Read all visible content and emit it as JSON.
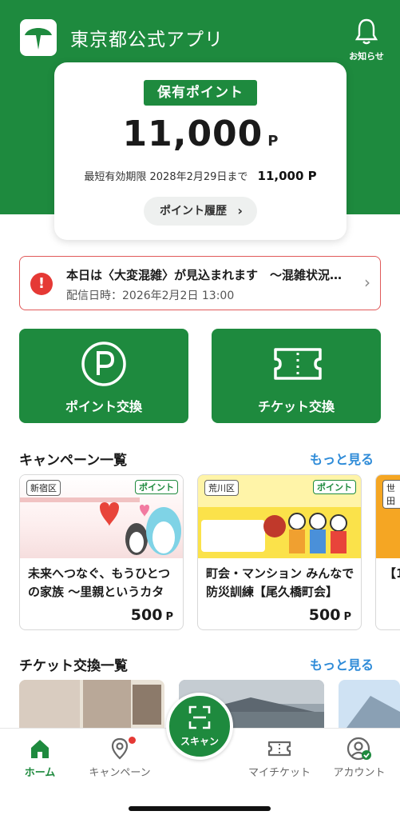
{
  "header": {
    "title": "東京都公式アプリ",
    "notifications_label": "お知らせ"
  },
  "points_card": {
    "badge": "保有ポイント",
    "value": "11,000",
    "unit": "P",
    "expiry_label": "最短有効期限",
    "expiry_date": "2028年2月29日まで",
    "expiry_amount": "11,000 P",
    "history_button": "ポイント履歴"
  },
  "alert": {
    "icon": "!",
    "title": "本日は〈大変混雑〉が見込まれます　～混雑状況について～",
    "date": "配信日時：2026年2月2日 13:00"
  },
  "actions": {
    "point_exchange": "ポイント交換",
    "ticket_exchange": "チケット交換"
  },
  "campaigns": {
    "section_title": "キャンペーン一覧",
    "more_label": "もっと見る",
    "items": [
      {
        "ward": "新宿区",
        "tag": "ポイント",
        "title": "未来へつなぐ、もうひとつの家族 〜里親というカタチ〜",
        "points": "500",
        "unit": "P"
      },
      {
        "ward": "荒川区",
        "tag": "ポイント",
        "title": "町会・マンション みんなで防災訓練【尾久橋町会】",
        "points": "500",
        "unit": "P"
      },
      {
        "ward": "世田",
        "title": "【1"
      }
    ]
  },
  "tickets": {
    "section_title": "チケット交換一覧",
    "more_label": "もっと見る"
  },
  "bottom_nav": {
    "home": "ホーム",
    "campaign": "キャンペーン",
    "scan": "スキャン",
    "my_ticket": "マイチケット",
    "account": "アカウント"
  },
  "colors": {
    "brand_green": "#1e8a3e",
    "alert_red": "#e53935",
    "link_blue": "#2e8bd8"
  }
}
